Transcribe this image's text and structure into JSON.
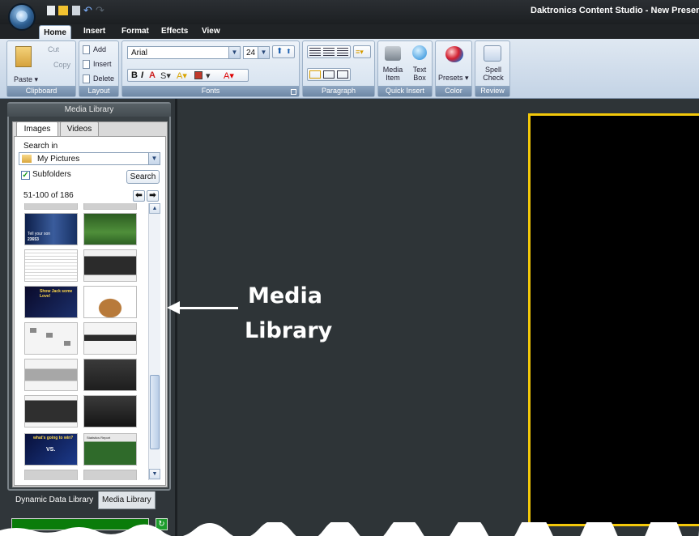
{
  "window": {
    "title": "Daktronics Content Studio - New Presentation ?"
  },
  "ribbon_tabs": [
    "Home",
    "Insert",
    "Format",
    "Effects",
    "View"
  ],
  "ribbon": {
    "clipboard": {
      "label": "Clipboard",
      "paste": "Paste",
      "cut": "Cut",
      "copy": "Copy"
    },
    "layout": {
      "label": "Layout",
      "add": "Add",
      "insert": "Insert",
      "delete": "Delete"
    },
    "fonts": {
      "label": "Fonts",
      "font_name": "Arial",
      "font_size": "24"
    },
    "paragraph": {
      "label": "Paragraph"
    },
    "quick_insert": {
      "label": "Quick Insert",
      "media_item_1": "Media",
      "media_item_2": "Item",
      "text_box_1": "Text",
      "text_box_2": "Box"
    },
    "color": {
      "label": "Color",
      "presets": "Presets"
    },
    "review": {
      "label": "Review",
      "spell_1": "Spell",
      "spell_2": "Check"
    }
  },
  "media_library": {
    "title": "Media Library",
    "tabs": [
      "Images",
      "Videos"
    ],
    "search_in_label": "Search in",
    "search_in_value": "My Pictures",
    "subfolders_label": "Subfolders",
    "subfolders_checked": true,
    "search_button": "Search",
    "paging": "51-100 of 186",
    "thumbnail_captions": {
      "promo1": "Tell your son",
      "promo1_num": "23653",
      "promo2": "Show Jack some Love!",
      "promo3": "what's going to win?",
      "promo3_vs": "VS.",
      "stats": "Statistics Report"
    }
  },
  "bottom_tabs": [
    "Dynamic Data Library",
    "Media Library"
  ],
  "callout": {
    "line1": "Media",
    "line2": "Library"
  },
  "colors": {
    "canvas_border": "#f3c80a",
    "workspace": "#2e3437",
    "progress": "#0a7c0a"
  }
}
